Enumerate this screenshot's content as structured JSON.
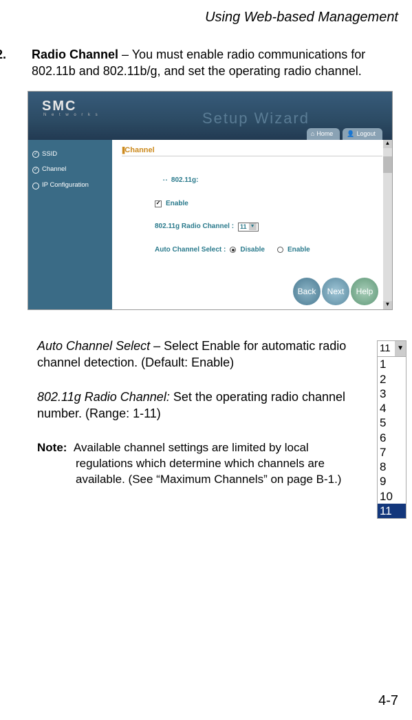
{
  "header": "Using Web-based Management",
  "step": {
    "number": "2.",
    "title": "Radio Channel",
    "text": " – You must enable radio communications for 802.11b and 802.11b/g, and set the operating radio channel."
  },
  "screenshot": {
    "logo": "SMC",
    "logo_sub": "N e t w o r k s",
    "wizard_text": "Setup Wizard",
    "home_btn": "Home",
    "logout_btn": "Logout",
    "sidebar": {
      "ssid": "SSID",
      "channel": "Channel",
      "ipconfig": "IP Configuration"
    },
    "main": {
      "title_prefix": "||| ",
      "title": "Channel",
      "section_802": "802.11g:",
      "enable_label": "Enable",
      "radio_channel_label": "802.11g Radio Channel :",
      "radio_channel_value": "11",
      "auto_label": "Auto Channel Select :",
      "auto_disable": "Disable",
      "auto_enable": "Enable"
    },
    "buttons": {
      "back": "Back",
      "next": "Next",
      "help": "Help"
    }
  },
  "desc": {
    "auto_title": "Auto Channel Select",
    "auto_text": " – Select Enable for automatic radio channel detection. (Default: Enable)",
    "radio_title": "802.11g Radio Channel:",
    "radio_text": " Set the operating radio channel number. (Range: 1-11)",
    "note_label": "Note:",
    "note_text": "Available channel settings are limited by local regulations which determine which channels are available. (See “Maximum Channels” on page B-1.)"
  },
  "dropdown": {
    "selected": "11",
    "options": [
      "1",
      "2",
      "3",
      "4",
      "5",
      "6",
      "7",
      "8",
      "9",
      "10",
      "11"
    ]
  },
  "page_number": "4-7"
}
